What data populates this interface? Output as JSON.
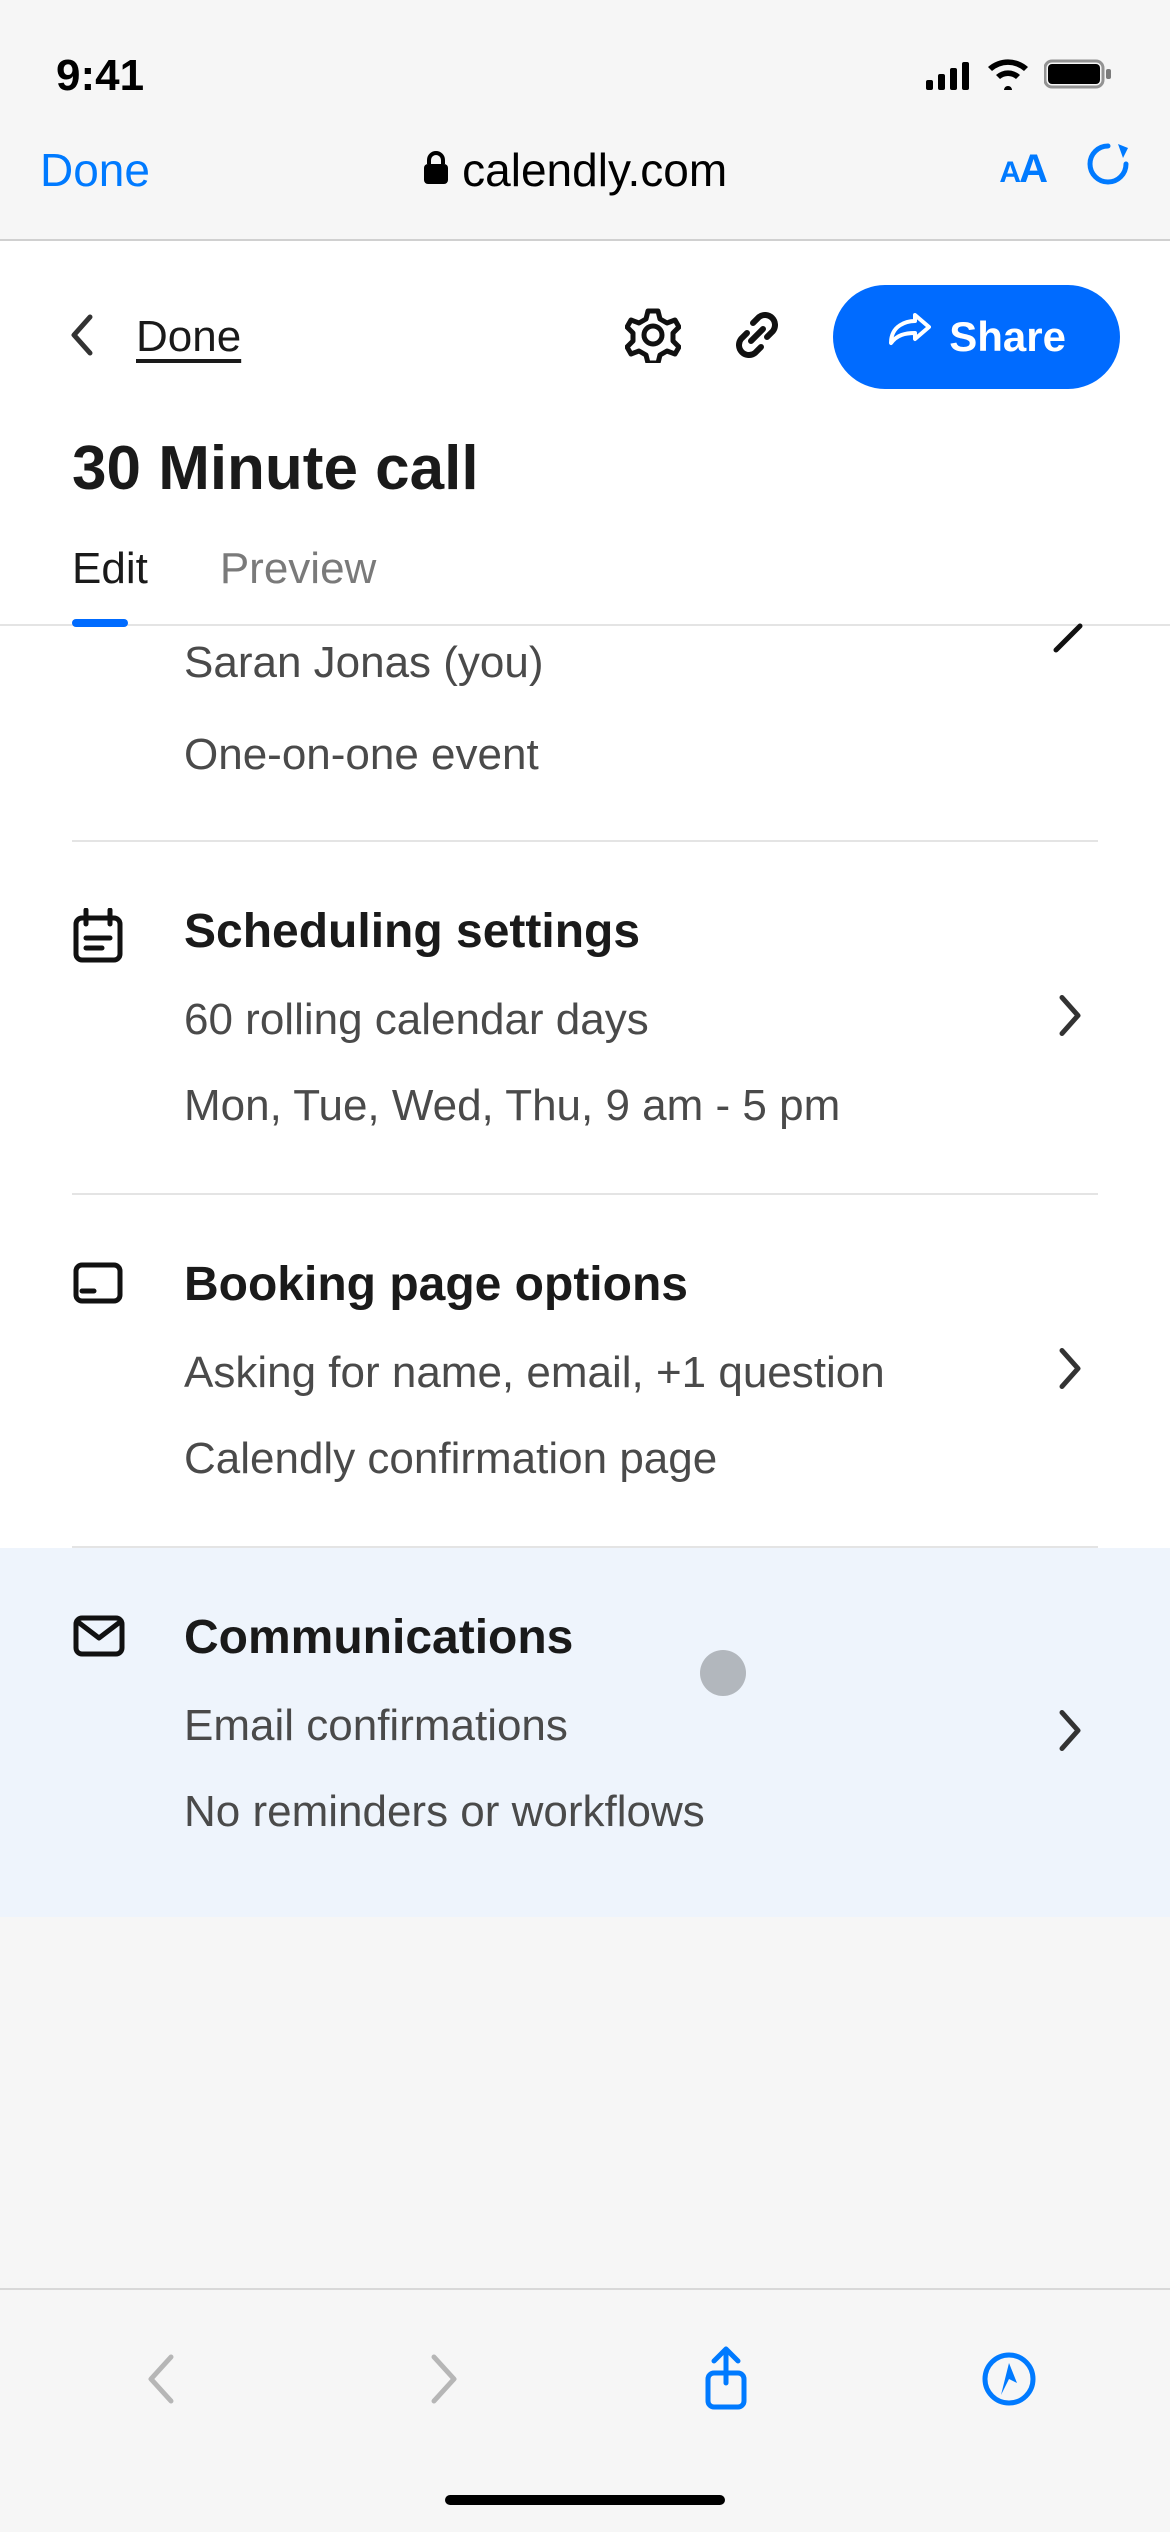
{
  "statusbar": {
    "time": "9:41"
  },
  "browser": {
    "done": "Done",
    "url": "calendly.com"
  },
  "app": {
    "back_done": "Done",
    "share": "Share",
    "title": "30 Minute call",
    "tabs": {
      "edit": "Edit",
      "preview": "Preview"
    },
    "host": {
      "name": "Saran Jonas (you)",
      "subtitle": "One-on-one event"
    },
    "sections": {
      "scheduling": {
        "title": "Scheduling settings",
        "line1": "60 rolling calendar days",
        "line2": "Mon, Tue, Wed, Thu, 9 am - 5 pm"
      },
      "booking": {
        "title": "Booking page options",
        "line1": "Asking for name, email, +1 question",
        "line2": "Calendly confirmation page"
      },
      "communications": {
        "title": "Communications",
        "line1": "Email confirmations",
        "line2": "No reminders or workflows"
      }
    }
  }
}
